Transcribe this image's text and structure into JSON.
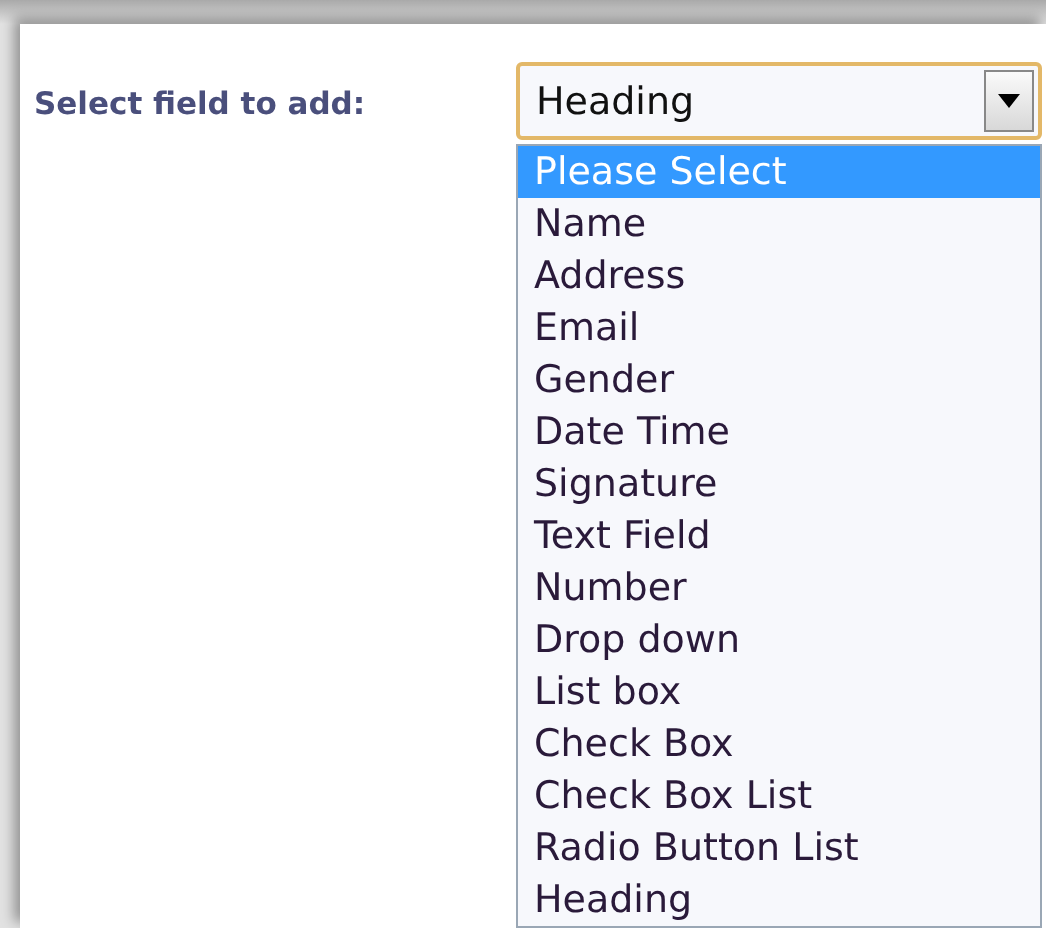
{
  "label": "Select field to add:",
  "select": {
    "value": "Heading",
    "expanded": true,
    "options": [
      {
        "label": "Please Select",
        "highlighted": true
      },
      {
        "label": "Name",
        "highlighted": false
      },
      {
        "label": "Address",
        "highlighted": false
      },
      {
        "label": "Email",
        "highlighted": false
      },
      {
        "label": "Gender",
        "highlighted": false
      },
      {
        "label": "Date Time",
        "highlighted": false
      },
      {
        "label": "Signature",
        "highlighted": false
      },
      {
        "label": "Text Field",
        "highlighted": false
      },
      {
        "label": "Number",
        "highlighted": false
      },
      {
        "label": "Drop down",
        "highlighted": false
      },
      {
        "label": "List box",
        "highlighted": false
      },
      {
        "label": "Check Box",
        "highlighted": false
      },
      {
        "label": "Check Box List",
        "highlighted": false
      },
      {
        "label": "Radio Button List",
        "highlighted": false
      },
      {
        "label": "Heading",
        "highlighted": false
      }
    ]
  }
}
